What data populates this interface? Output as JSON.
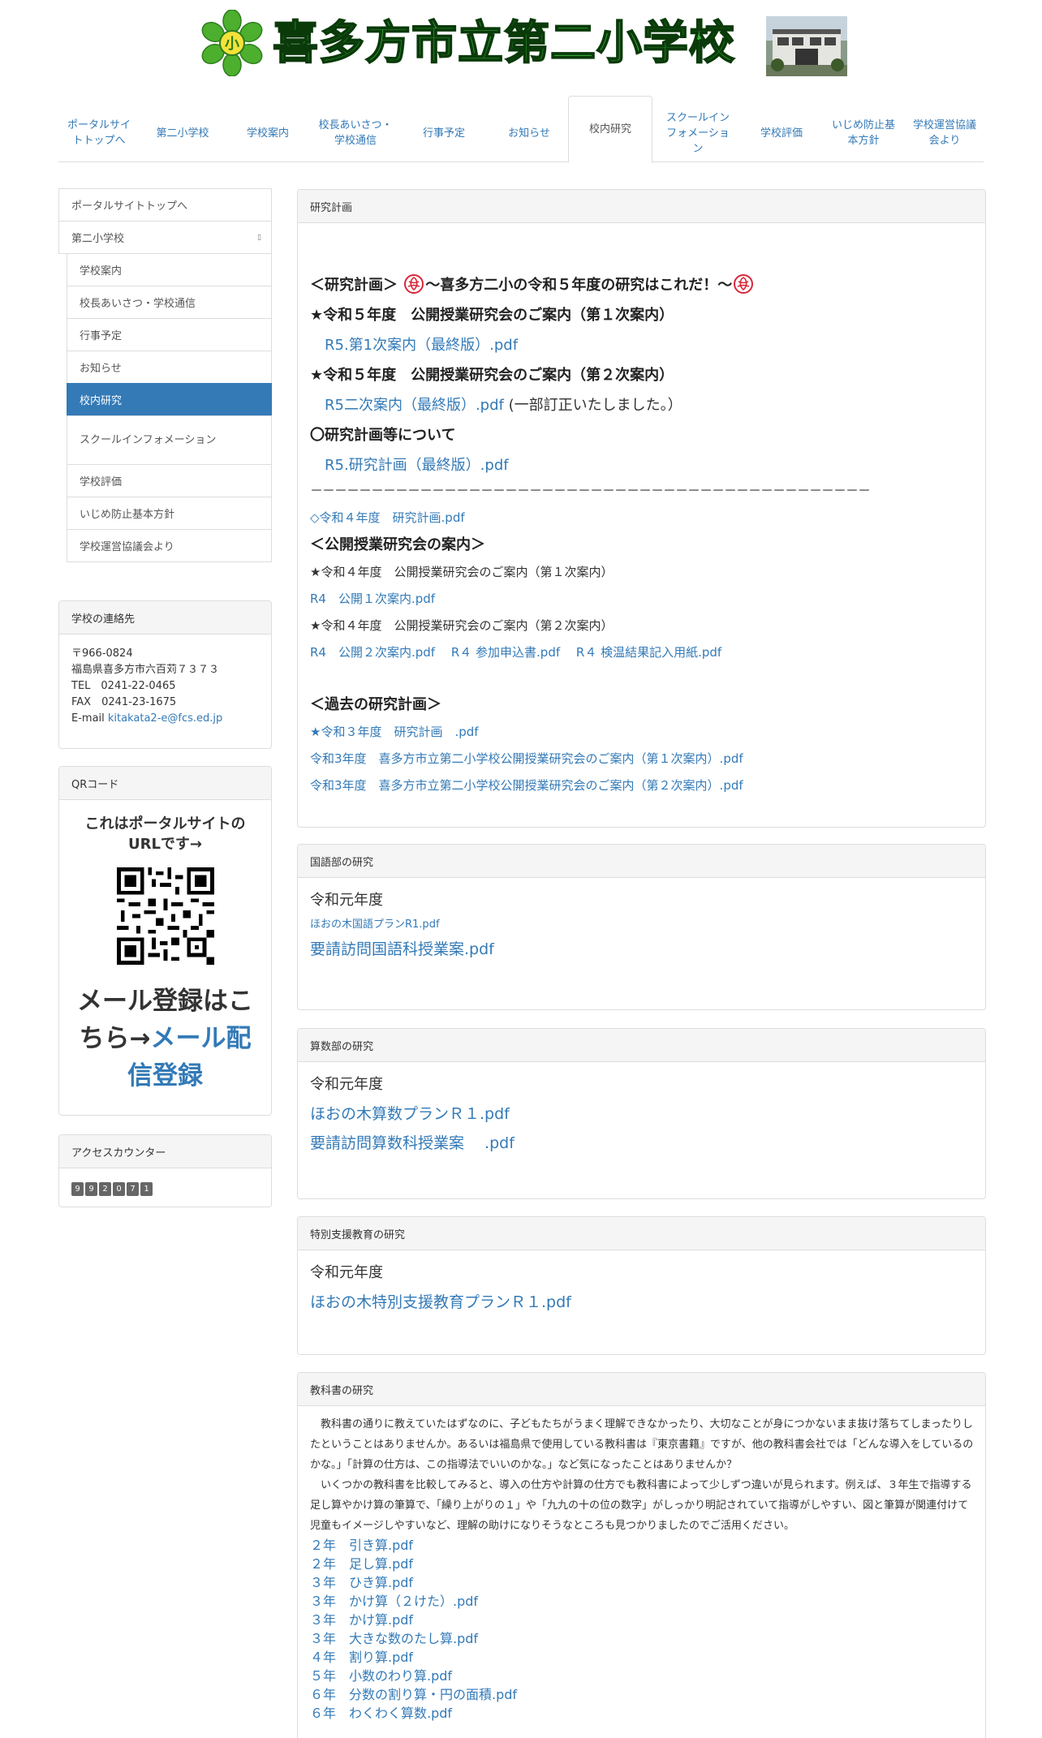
{
  "header": {
    "school_name": "喜多方市立第二小学校",
    "emblem_char": "小"
  },
  "nav": [
    {
      "label": "ポータルサイトトップへ"
    },
    {
      "label": "第二小学校"
    },
    {
      "label": "学校案内"
    },
    {
      "label": "校長あいさつ・学校通信"
    },
    {
      "label": "行事予定"
    },
    {
      "label": "お知らせ"
    },
    {
      "label": "校内研究",
      "active": true
    },
    {
      "label": "スクールインフォメーション"
    },
    {
      "label": "学校評価"
    },
    {
      "label": "いじめ防止基本方針"
    },
    {
      "label": "学校運営協議会より"
    }
  ],
  "sidebar": {
    "menu": [
      {
        "label": "ポータルサイトトップへ"
      },
      {
        "label": "第二小学校",
        "caret": "▯"
      },
      {
        "label": "学校案内"
      },
      {
        "label": "校長あいさつ・学校通信"
      },
      {
        "label": "行事予定"
      },
      {
        "label": "お知らせ"
      },
      {
        "label": "校内研究"
      },
      {
        "label": "スクールインフォメーション"
      },
      {
        "label": "学校評価"
      },
      {
        "label": "いじめ防止基本方針"
      },
      {
        "label": "学校運営協議会より"
      }
    ],
    "contact": {
      "title": "学校の連絡先",
      "postal": "〒966-0824",
      "address": "福島県喜多方市六百苅７３７３",
      "tel": "TEL　0241-22-0465",
      "fax": "FAX　0241-23-1675",
      "email_label": "E-mail ",
      "email": "kitakata2-e@fcs.ed.jp"
    },
    "qr": {
      "title": "QRコード",
      "text": "これはポータルサイトのURLです→",
      "mail_text": "メール登録はこちら→",
      "mail_link": "メール配信登録"
    },
    "counter": {
      "title": "アクセスカウンター",
      "digits": [
        "9",
        "9",
        "2",
        "0",
        "7",
        "1"
      ]
    }
  },
  "research_plan": {
    "title": "研究計画",
    "heading": "＜研究計画＞",
    "heading_tail": "～喜多方二小の令和５年度の研究はこれだ！～",
    "first_notice": "★令和５年度　公開授業研究会のご案内（第１次案内）",
    "first_link": "R5.第1次案内（最終版）.pdf",
    "second_notice": "★令和５年度　公開授業研究会のご案内（第２次案内）",
    "second_link": "R5二次案内（最終版）.pdf",
    "second_note": "(一部訂正いたしました。）",
    "plan_heading": "〇研究計画等について",
    "plan_link": "R5.研究計画（最終版）.pdf",
    "separator": "－－－－－－－－－－－－－－－－－－－－－－－－－－－－－－－－－－－－－－－－－－－－－－",
    "r4_plan_link": "◇令和４年度　研究計画.pdf",
    "open_heading": "＜公開授業研究会の案内＞",
    "r4_first_notice": "★令和４年度　公開授業研究会のご案内（第１次案内）",
    "r4_first_link": "R4　公開１次案内.pdf",
    "r4_second_notice": "★令和４年度　公開授業研究会のご案内（第２次案内）",
    "r4_second_links": [
      "R4　公開２次案内.pdf",
      "R４ 参加申込書.pdf",
      "R４ 検温結果記入用紙.pdf"
    ],
    "past_heading": "＜過去の研究計画＞",
    "past_links": [
      "★令和３年度　研究計画　.pdf",
      "令和3年度　喜多方市立第二小学校公開授業研究会のご案内（第１次案内）.pdf",
      "令和3年度　喜多方市立第二小学校公開授業研究会のご案内（第２次案内）.pdf"
    ]
  },
  "japanese": {
    "title": "国語部の研究",
    "year": "令和元年度",
    "link1": "ほおの木国語プランR1.pdf",
    "link2": "要請訪問国語科授業案.pdf"
  },
  "math": {
    "title": "算数部の研究",
    "year": "令和元年度",
    "link1": "ほおの木算数プランＲ１.pdf",
    "link2": "要請訪問算数科授業案　 .pdf"
  },
  "special": {
    "title": "特別支援教育の研究",
    "year": "令和元年度",
    "link1": "ほおの木特別支援教育プランＲ１.pdf"
  },
  "textbook": {
    "title": "教科書の研究",
    "para1": "　教科書の通りに教えていたはずなのに、子どもたちがうまく理解できなかったり、大切なことが身につかないまま抜け落ちてしまったりしたということはありませんか。あるいは福島県で使用している教科書は『東京書籍』ですが、他の教科書会社では「どんな導入をしているのかな。」「計算の仕方は、この指導法でいいのかな。」など気になったことはありませんか？",
    "para2": "　いくつかの教科書を比較してみると、導入の仕方や計算の仕方でも教科書によって少しずつ違いが見られます。例えば、３年生で指導する足し算やかけ算の筆算で、「繰り上がりの１」や「九九の十の位の数字」がしっかり明記されていて指導がしやすい、図と筆算が関連付けて児童もイメージしやすいなど、理解の助けになりそうなところも見つかりましたのでご活用ください。",
    "links": [
      "２年　引き算.pdf",
      "２年　足し算.pdf",
      "３年　ひき算.pdf",
      "３年　かけ算（２けた）.pdf",
      "３年　かけ算.pdf",
      "３年　大きな数のたし算.pdf",
      "４年　割り算.pdf",
      "５年　小数のわり算.pdf",
      "６年　分数の割り算・円の面積.pdf",
      "６年　わくわく算数.pdf"
    ]
  }
}
